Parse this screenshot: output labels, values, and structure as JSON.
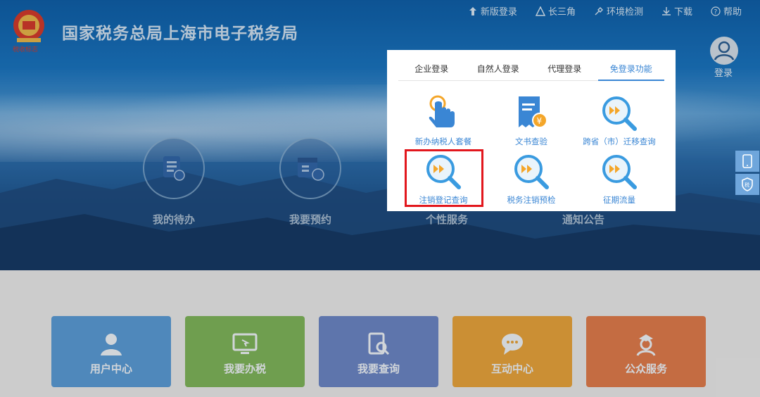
{
  "header": {
    "site_title": "国家税务总局上海市电子税务局",
    "topnav": [
      {
        "icon": "new-login-icon",
        "label": "新版登录"
      },
      {
        "icon": "triangle-icon",
        "label": "长三角"
      },
      {
        "icon": "tool-icon",
        "label": "环境检测"
      },
      {
        "icon": "download-icon",
        "label": "下载"
      },
      {
        "icon": "help-icon",
        "label": "帮助"
      }
    ],
    "login_label": "登录"
  },
  "hero": {
    "services": [
      {
        "icon": "todo-icon",
        "label": "我的待办"
      },
      {
        "icon": "calendar-icon",
        "label": "我要预约"
      },
      {
        "icon": "",
        "label": "个性服务"
      },
      {
        "icon": "",
        "label": "通知公告"
      }
    ]
  },
  "login_panel": {
    "tabs": [
      "企业登录",
      "自然人登录",
      "代理登录",
      "免登录功能"
    ],
    "active_tab": "免登录功能",
    "functions": [
      {
        "icon": "hand-touch-icon",
        "label": "新办纳税人套餐"
      },
      {
        "icon": "document-yen-icon",
        "label": "文书查验"
      },
      {
        "icon": "magnifier-icon",
        "label": "跨省（市）迁移查询"
      },
      {
        "icon": "magnifier-icon",
        "label": "注销登记查询"
      },
      {
        "icon": "magnifier-icon",
        "label": "税务注销预检"
      },
      {
        "icon": "magnifier-icon",
        "label": "征期流量"
      }
    ],
    "highlighted": "注销登记查询"
  },
  "tiles": [
    {
      "icon": "user-icon",
      "label": "用户中心",
      "color": "#5b9bd5"
    },
    {
      "icon": "monitor-icon",
      "label": "我要办税",
      "color": "#7fb45a"
    },
    {
      "icon": "search-doc-icon",
      "label": "我要查询",
      "color": "#6b86c4"
    },
    {
      "icon": "chat-icon",
      "label": "互动中心",
      "color": "#e8a33c"
    },
    {
      "icon": "person-icon",
      "label": "公众服务",
      "color": "#e07c4c"
    }
  ],
  "colors": {
    "accent": "#3a86d4",
    "highlight": "#e2171d"
  }
}
